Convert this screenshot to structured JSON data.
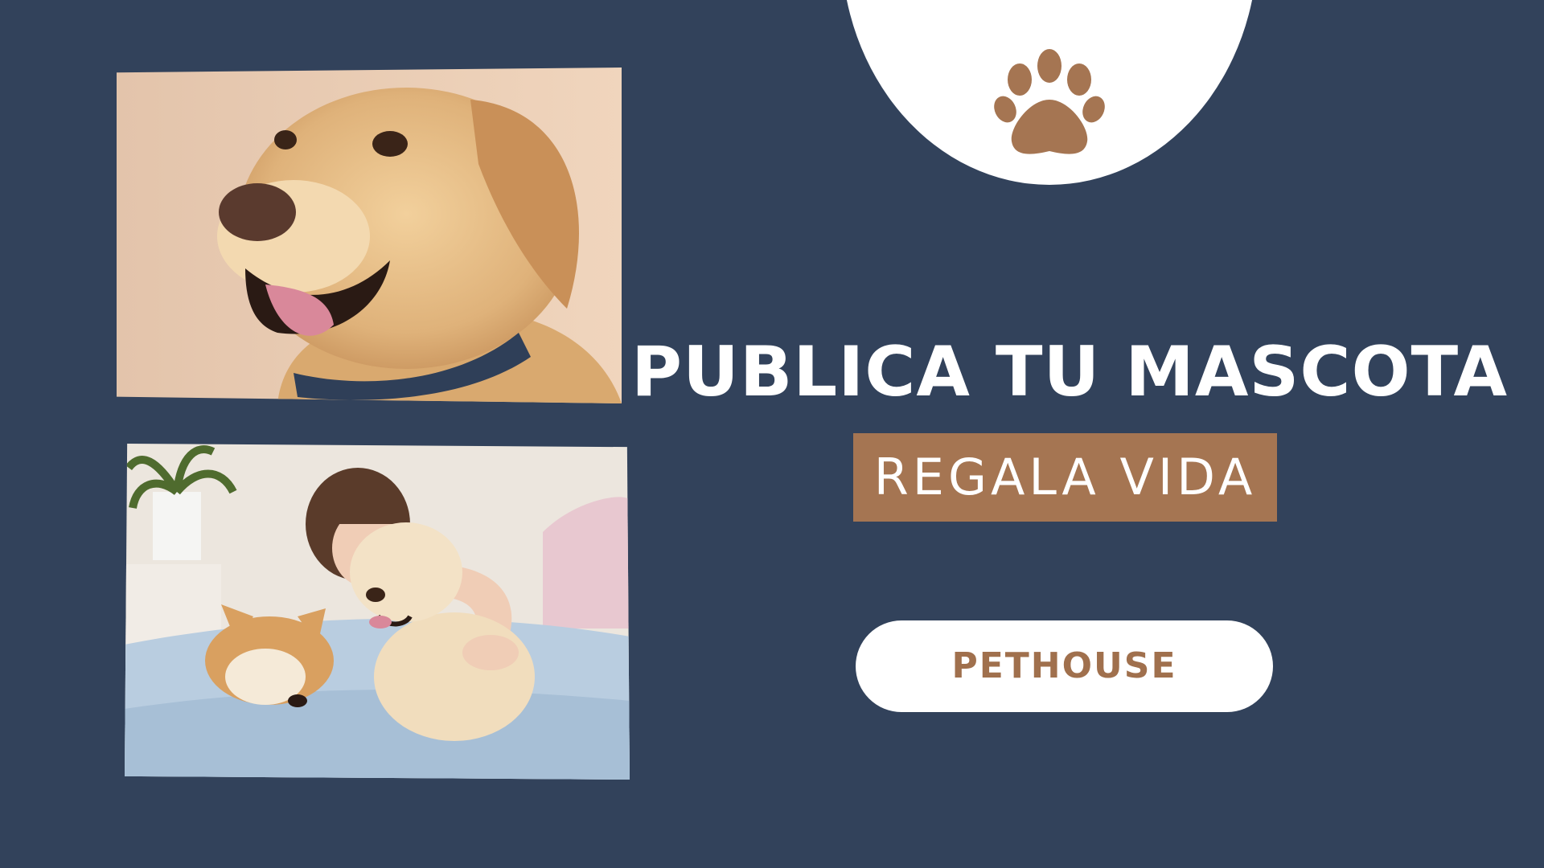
{
  "banner": {
    "headline": "PUBLICA TU MASCOTA",
    "tagline": "REGALA VIDA",
    "cta_label": "PETHOUSE"
  },
  "icons": {
    "badge": "paw-print-icon"
  },
  "colors": {
    "background": "#32425b",
    "accent": "#a57552",
    "cta_text": "#a0704d",
    "white": "#ffffff"
  }
}
